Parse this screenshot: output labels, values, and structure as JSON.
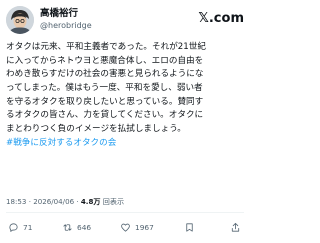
{
  "post": {
    "author": {
      "display_name": "高橋裕行",
      "handle": "@herobridge"
    },
    "brand_text": "𝕏.com",
    "text_lines": [
      "オタクは元来、平和主義者であった。それが21世紀",
      "に入ってからネトウヨと悪魔合体し、エロの自由を",
      "わめき散らすだけの社会の害悪と見られるようにな",
      "ってしまった。僕はもう一度、平和を愛し、弱い者",
      "を守るオタクを取り戻したいと思っている。賛同す",
      "るオタクの皆さん、力を貸してください。オタクに",
      "まとわりつく負のイメージを払拭しましょう。"
    ],
    "hashtag": "#戦争に反対するオタクの会",
    "timestamp": "18:53 · 2026/04/06 · ",
    "views": "4.8万",
    "views_label": "回表示",
    "counts": {
      "replies": "71",
      "reposts": "646",
      "likes": "1967"
    },
    "colors": {
      "link": "#1d9bf0",
      "secondary": "#536471"
    }
  }
}
